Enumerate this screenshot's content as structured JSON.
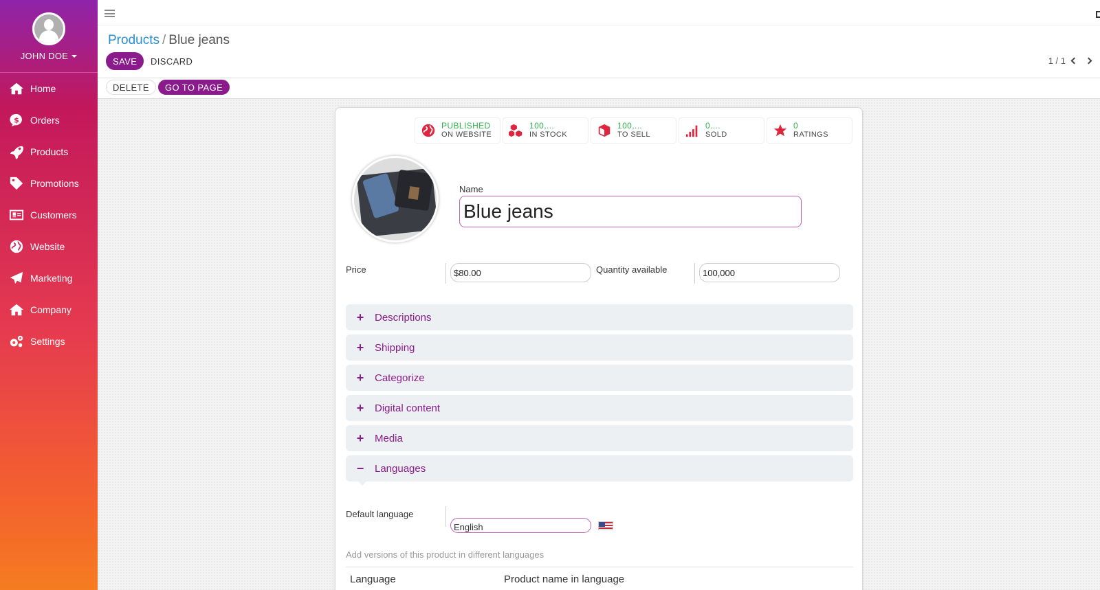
{
  "user": {
    "name": "JOHN DOE"
  },
  "sidebar": {
    "items": [
      {
        "label": "Home",
        "icon": "home-icon"
      },
      {
        "label": "Orders",
        "icon": "dollar-bubble-icon"
      },
      {
        "label": "Products",
        "icon": "rocket-icon"
      },
      {
        "label": "Promotions",
        "icon": "tag-icon"
      },
      {
        "label": "Customers",
        "icon": "address-card-icon"
      },
      {
        "label": "Website",
        "icon": "globe-icon"
      },
      {
        "label": "Marketing",
        "icon": "paper-plane-icon"
      },
      {
        "label": "Company",
        "icon": "home-icon"
      },
      {
        "label": "Settings",
        "icon": "gears-icon"
      }
    ]
  },
  "breadcrumb": {
    "parent": "Products",
    "separator": "/",
    "current": "Blue jeans"
  },
  "toolbar": {
    "save": "SAVE",
    "discard": "DISCARD",
    "delete": "DELETE",
    "go_to_page": "GO TO PAGE"
  },
  "pager": {
    "text": "1 / 1"
  },
  "stats": [
    {
      "value": "PUBLISHED",
      "label": "ON WEBSITE",
      "icon": "globe-icon",
      "color": "#e0263e"
    },
    {
      "value": "100,...",
      "label": "IN STOCK",
      "icon": "cubes-icon",
      "color": "#e0263e"
    },
    {
      "value": "100,...",
      "label": "TO SELL",
      "icon": "cube-icon",
      "color": "#e0263e"
    },
    {
      "value": "0....",
      "label": "SOLD",
      "icon": "signal-icon",
      "color": "#e0263e"
    },
    {
      "value": "0",
      "label": "RATINGS",
      "icon": "star-icon",
      "color": "#e0263e"
    }
  ],
  "form": {
    "name_label": "Name",
    "name_value": "Blue jeans",
    "price_label": "Price",
    "price_value": "$80.00",
    "qty_label": "Quantity available",
    "qty_value": "100,000"
  },
  "sections": [
    {
      "title": "Descriptions",
      "sign": "+"
    },
    {
      "title": "Shipping",
      "sign": "+"
    },
    {
      "title": "Categorize",
      "sign": "+"
    },
    {
      "title": "Digital content",
      "sign": "+"
    },
    {
      "title": "Media",
      "sign": "+"
    },
    {
      "title": "Languages",
      "sign": "−"
    }
  ],
  "languages": {
    "default_label": "Default language",
    "default_value": "English",
    "hint": "Add versions of this product in different languages",
    "col_language": "Language",
    "col_product_name": "Product name in language"
  },
  "colors": {
    "accent": "#8b1b8c",
    "link": "#2a8fd0",
    "stat_value": "#2eb34a",
    "stat_icon": "#e0263e"
  }
}
